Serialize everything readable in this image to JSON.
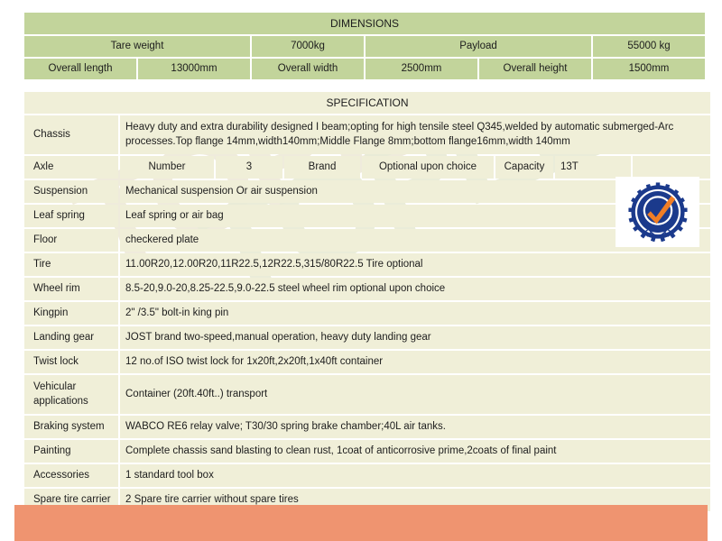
{
  "watermark": {
    "text_primary": "TOPLEAD",
    "text_secondary": "TOPLEAD",
    "color": "#efeadb"
  },
  "colors": {
    "dimensions_cell": "#c2d49b",
    "specification_cell": "#f0efd8",
    "footer_bar": "#ef9470",
    "text": "#1d1d1d",
    "badge_blue": "#1b3a8c",
    "badge_orange": "#f07e26"
  },
  "dimensions": {
    "title": "DIMENSIONS",
    "rows": [
      [
        {
          "text": "Tare weight"
        },
        {
          "text": "7000kg"
        },
        {
          "text": "Payload"
        },
        {
          "text": "55000 kg"
        }
      ],
      [
        {
          "text": "Overall length"
        },
        {
          "text": "13000mm"
        },
        {
          "text": "Overall width"
        },
        {
          "text": "2500mm"
        },
        {
          "text": "Overall height"
        },
        {
          "text": "1500mm"
        }
      ]
    ]
  },
  "specification": {
    "title": "SPECIFICATION",
    "rows": [
      {
        "label": "Chassis",
        "value": "Heavy duty and extra durability designed I beam;opting for high tensile steel Q345,welded by automatic submerged-Arc processes.Top flange 14mm,width140mm;Middle Flange 8mm;bottom flange16mm,width 140mm"
      },
      {
        "label": "Axle",
        "cells": [
          "Number",
          "3",
          "Brand",
          "Optional upon choice",
          "Capacity",
          "13T",
          ""
        ]
      },
      {
        "label": "Suspension",
        "value": "Mechanical suspension Or air suspension"
      },
      {
        "label": "Leaf spring",
        "value": "Leaf spring or air bag"
      },
      {
        "label": "Floor",
        "value": "checkered plate"
      },
      {
        "label": "Tire",
        "value": "11.00R20,12.00R20,11R22.5,12R22.5,315/80R22.5 Tire optional"
      },
      {
        "label": "Wheel rim",
        "value": "8.5-20,9.0-20,8.25-22.5,9.0-22.5 steel wheel rim optional upon choice"
      },
      {
        "label": "Kingpin",
        "value": "2\" /3.5\" bolt-in king pin"
      },
      {
        "label": "Landing gear",
        "value": "JOST brand two-speed,manual operation, heavy duty landing gear"
      },
      {
        "label": "Twist lock",
        "value": "12 no.of  ISO twist lock for 1x20ft,2x20ft,1x40ft container"
      },
      {
        "label": "Vehicular applications",
        "value": "Container (20ft.40ft..) transport"
      },
      {
        "label": "Braking system",
        "value": "WABCO RE6 relay valve; T30/30 spring brake chamber;40L air tanks."
      },
      {
        "label": "Painting",
        "value": "Complete chassis sand blasting to clean rust, 1coat of anticorrosive prime,2coats of final paint"
      },
      {
        "label": "Accessories",
        "value": "1 standard tool box"
      },
      {
        "label": "Spare tire carrier",
        "value": "2 Spare tire carrier without spare tires"
      }
    ]
  },
  "supplier_badge": {
    "label": "Supplier Assessment",
    "icon": "check-seal-icon"
  }
}
